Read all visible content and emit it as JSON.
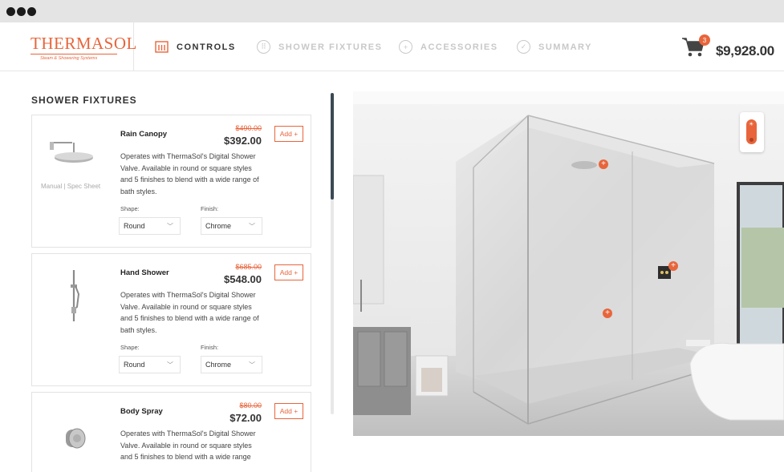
{
  "app": {
    "brand": "THERMASOL",
    "tagline": "Steam & Showering Systems"
  },
  "steps": [
    {
      "label": "CONTROLS",
      "icon": "controls-icon",
      "active": true
    },
    {
      "label": "SHOWER FIXTURES",
      "icon": "grid-circle-icon",
      "active": false
    },
    {
      "label": "ACCESSORIES",
      "icon": "plus-circle-icon",
      "active": false
    },
    {
      "label": "SUMMARY",
      "icon": "check-circle-icon",
      "active": false
    }
  ],
  "cart": {
    "count": "3",
    "total": "$9,928.00"
  },
  "section": {
    "title": "SHOWER FIXTURES"
  },
  "products": [
    {
      "name": "Rain Canopy",
      "old_price": "$490.00",
      "price": "$392.00",
      "add_label": "Add +",
      "description": "Operates with ThermaSol's Digital Shower Valve. Available in round or square styles and 5 finishes to blend with a wide range of bath styles.",
      "links": "Manual | Spec Sheet",
      "shape_label": "Shape:",
      "shape_value": "Round",
      "finish_label": "Finish:",
      "finish_value": "Chrome"
    },
    {
      "name": "Hand Shower",
      "old_price": "$685.00",
      "price": "$548.00",
      "add_label": "Add +",
      "description": "Operates with ThermaSol's Digital Shower Valve. Available in round or square styles and 5 finishes to blend with a wide range of bath styles.",
      "shape_label": "Shape:",
      "shape_value": "Round",
      "finish_label": "Finish:",
      "finish_value": "Chrome"
    },
    {
      "name": "Body Spray",
      "old_price": "$80.00",
      "price": "$72.00",
      "add_label": "Add +",
      "description": "Operates with ThermaSol's Digital Shower Valve. Available in round or square styles and 5 finishes to blend with a wide range"
    }
  ],
  "hotspots": [
    {
      "label": "+"
    },
    {
      "label": "+"
    },
    {
      "label": "+"
    }
  ],
  "colors": {
    "accent": "#e8653b",
    "dark": "#3a4a55"
  }
}
